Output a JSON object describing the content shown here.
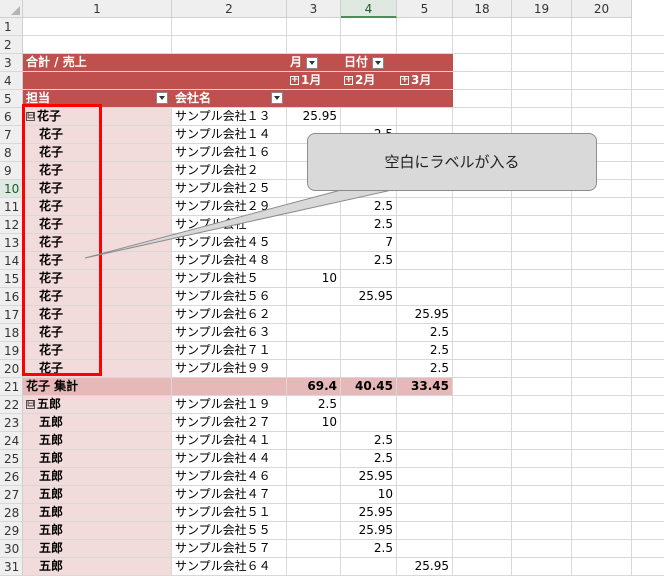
{
  "columns": [
    {
      "label": "1"
    },
    {
      "label": "2"
    },
    {
      "label": "3"
    },
    {
      "label": "4",
      "selected": true
    },
    {
      "label": "5"
    },
    {
      "label": "18"
    },
    {
      "label": "19"
    },
    {
      "label": "20"
    }
  ],
  "row_numbers": [
    "1",
    "2",
    "3",
    "4",
    "5",
    "6",
    "7",
    "8",
    "9",
    "10",
    "11",
    "12",
    "13",
    "14",
    "15",
    "16",
    "17",
    "18",
    "19",
    "20",
    "21",
    "22",
    "23",
    "24",
    "25",
    "26",
    "27",
    "28",
    "29",
    "30",
    "31"
  ],
  "selected_row": "10",
  "pivot": {
    "value_label": "合計 / 売上",
    "col_field_month": "月",
    "col_field_date": "日付",
    "months": [
      "1月",
      "2月",
      "3月"
    ],
    "row_field_person": "担当",
    "row_field_company": "会社名",
    "expand_minus": "⊟",
    "expand_plus": "+"
  },
  "rows": [
    {
      "person": "花子",
      "company": "サンプル会社１３",
      "m1": "25.95",
      "m2": "",
      "m3": "",
      "first": true
    },
    {
      "person": "花子",
      "company": "サンプル会社１４",
      "m1": "",
      "m2": "2.5",
      "m3": ""
    },
    {
      "person": "花子",
      "company": "サンプル会社１６",
      "m1": "",
      "m2": "",
      "m3": ""
    },
    {
      "person": "花子",
      "company": "サンプル会社２",
      "m1": "",
      "m2": "",
      "m3": ""
    },
    {
      "person": "花子",
      "company": "サンプル会社２５",
      "m1": "",
      "m2": "",
      "m3": ""
    },
    {
      "person": "花子",
      "company": "サンプル会社２９",
      "m1": "",
      "m2": "2.5",
      "m3": ""
    },
    {
      "person": "花子",
      "company": "サンプル会社",
      "m1": "",
      "m2": "2.5",
      "m3": ""
    },
    {
      "person": "花子",
      "company": "サンプル会社４５",
      "m1": "",
      "m2": "7",
      "m3": ""
    },
    {
      "person": "花子",
      "company": "サンプル会社４８",
      "m1": "",
      "m2": "2.5",
      "m3": ""
    },
    {
      "person": "花子",
      "company": "サンプル会社５",
      "m1": "10",
      "m2": "",
      "m3": ""
    },
    {
      "person": "花子",
      "company": "サンプル会社５６",
      "m1": "",
      "m2": "25.95",
      "m3": ""
    },
    {
      "person": "花子",
      "company": "サンプル会社６２",
      "m1": "",
      "m2": "",
      "m3": "25.95"
    },
    {
      "person": "花子",
      "company": "サンプル会社６３",
      "m1": "",
      "m2": "",
      "m3": "2.5"
    },
    {
      "person": "花子",
      "company": "サンプル会社７１",
      "m1": "",
      "m2": "",
      "m3": "2.5"
    },
    {
      "person": "花子",
      "company": "サンプル会社９９",
      "m1": "",
      "m2": "",
      "m3": "2.5"
    }
  ],
  "subtotal": {
    "label": "花子 集計",
    "m1": "69.4",
    "m2": "40.45",
    "m3": "33.45"
  },
  "rows2": [
    {
      "person": "五郎",
      "company": "サンプル会社１９",
      "m1": "2.5",
      "m2": "",
      "m3": "",
      "first": true
    },
    {
      "person": "五郎",
      "company": "サンプル会社２７",
      "m1": "10",
      "m2": "",
      "m3": ""
    },
    {
      "person": "五郎",
      "company": "サンプル会社４１",
      "m1": "",
      "m2": "2.5",
      "m3": ""
    },
    {
      "person": "五郎",
      "company": "サンプル会社４４",
      "m1": "",
      "m2": "2.5",
      "m3": ""
    },
    {
      "person": "五郎",
      "company": "サンプル会社４６",
      "m1": "",
      "m2": "25.95",
      "m3": ""
    },
    {
      "person": "五郎",
      "company": "サンプル会社４７",
      "m1": "",
      "m2": "10",
      "m3": ""
    },
    {
      "person": "五郎",
      "company": "サンプル会社５１",
      "m1": "",
      "m2": "25.95",
      "m3": ""
    },
    {
      "person": "五郎",
      "company": "サンプル会社５５",
      "m1": "",
      "m2": "25.95",
      "m3": ""
    },
    {
      "person": "五郎",
      "company": "サンプル会社５７",
      "m1": "",
      "m2": "2.5",
      "m3": ""
    },
    {
      "person": "五郎",
      "company": "サンプル会社６４",
      "m1": "",
      "m2": "",
      "m3": "25.95"
    }
  ],
  "callout": {
    "text": "空白にラベルが入る"
  },
  "colors": {
    "header_red": "#c0504d",
    "label_pink": "#f2dcdb",
    "subtotal_pink": "#e6b8b7",
    "highlight_box": "#ff0000",
    "callout_fill": "#d9d9d9"
  }
}
